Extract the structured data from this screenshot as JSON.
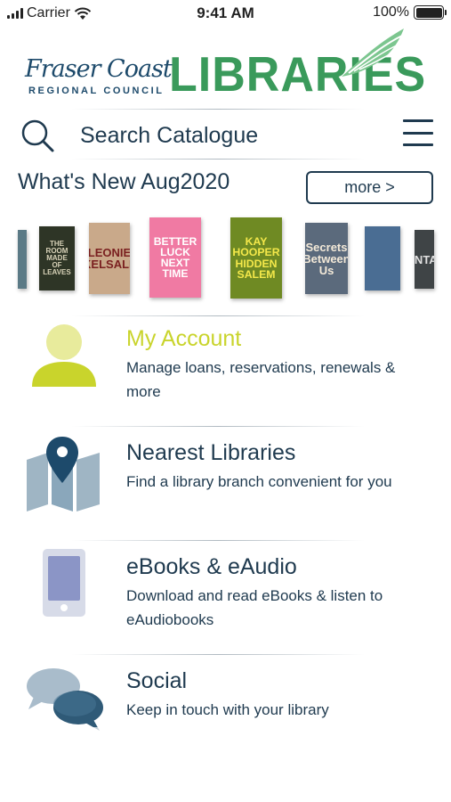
{
  "status_bar": {
    "carrier": "Carrier",
    "time": "9:41 AM",
    "battery": "100%",
    "battery_level": 1.0
  },
  "logo": {
    "fraser_coast": "Fraser Coast",
    "council": "REGIONAL COUNCIL",
    "libraries": "LIBRARIES"
  },
  "search": {
    "placeholder": "Search Catalogue"
  },
  "whats_new": {
    "title": "What's New Aug2020",
    "more_label": "more >"
  },
  "books": [
    {
      "lines": [
        ""
      ],
      "color": "#5b7a86",
      "text_color": "#e8eef0"
    },
    {
      "lines": [
        "THE",
        "ROOM",
        "MADE",
        "OF",
        "LEAVES"
      ],
      "color": "#2e3526",
      "text_color": "#d8d2b8"
    },
    {
      "lines": [
        "LEONIE",
        "KELSALL"
      ],
      "color": "#c9a98a",
      "text_color": "#7a2020"
    },
    {
      "lines": [
        "BETTER",
        "LUCK",
        "NEXT",
        "TIME"
      ],
      "color": "#f07aa3",
      "text_color": "#ffffff"
    },
    {
      "lines": [
        "KAY",
        "HOOPER",
        "HIDDEN",
        "SALEM"
      ],
      "color": "#6f8a23",
      "text_color": "#f4e84a"
    },
    {
      "lines": [
        "Secrets",
        "Between Us"
      ],
      "color": "#5b6a7c",
      "text_color": "#f3e9d8"
    },
    {
      "lines": [
        ""
      ],
      "color": "#4a6d93",
      "text_color": "#f2f2f2"
    },
    {
      "lines": [
        "INTA"
      ],
      "color": "#3f4446",
      "text_color": "#e0e0e0"
    }
  ],
  "menu": [
    {
      "title": "My Account",
      "description": "Manage loans, reservations, renewals & more",
      "icon": "person-icon"
    },
    {
      "title": "Nearest Libraries",
      "description": "Find a library branch convenient for you",
      "icon": "map-pin-icon"
    },
    {
      "title": "eBooks & eAudio",
      "description": "Download and read eBooks & listen to eAudiobooks",
      "icon": "tablet-icon"
    },
    {
      "title": "Social",
      "description": "Keep in touch with your library",
      "icon": "chat-bubbles-icon"
    }
  ],
  "colors": {
    "navy": "#1f3a4f",
    "accent_yellow": "#c9d42c",
    "libraries_green": "#3a9a5b",
    "icon_blue_grey": "#8aa7bb"
  }
}
